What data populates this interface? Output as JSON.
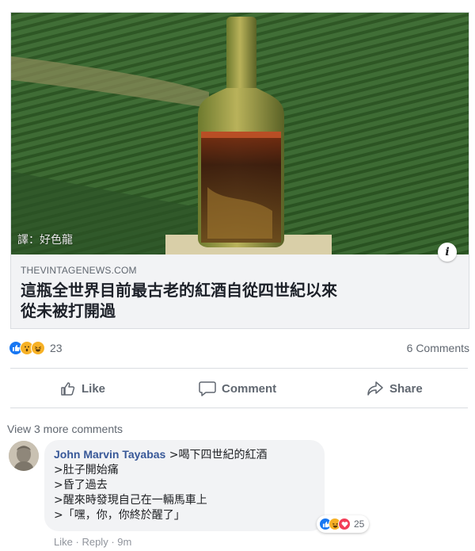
{
  "post": {
    "watermark": "譯：好色龍",
    "domain": "THEVINTAGENEWS.COM",
    "headline": "這瓶全世界目前最古老的紅酒自從四世紀以來\n從未被打開過"
  },
  "stats": {
    "reaction_icons": [
      "like",
      "wow",
      "haha"
    ],
    "reaction_count": "23",
    "comments_count": "6 Comments"
  },
  "actions": {
    "like": "Like",
    "comment": "Comment",
    "share": "Share"
  },
  "comments": {
    "view_more": "View 3 more comments",
    "items": [
      {
        "author": "John Marvin Tayabas",
        "text": " >喝下四世紀的紅酒\n>肚子開始痛\n>昏了過去\n>醒來時發現自己在一輛馬車上\n>「嘿，你，你終於醒了」",
        "reaction_icons": [
          "like",
          "haha",
          "love"
        ],
        "reaction_count": "25",
        "like_label": "Like",
        "reply_label": "Reply",
        "separator": "·",
        "time": "9m"
      }
    ]
  },
  "colors": {
    "accent": "#385898",
    "like_blue": "#1877f2",
    "muted": "#606770"
  }
}
